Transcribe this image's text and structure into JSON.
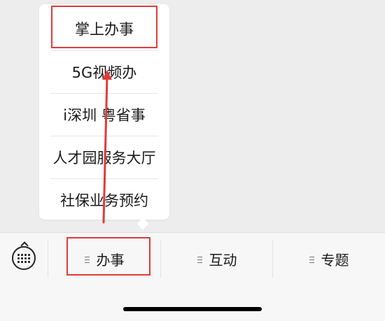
{
  "popup_menu": {
    "items": [
      {
        "label": "掌上办事"
      },
      {
        "label": "5G视频办"
      },
      {
        "label": "i深圳 粤省事"
      },
      {
        "label": "人才园服务大厅"
      },
      {
        "label": "社保业务预约"
      }
    ]
  },
  "bottom_bar": {
    "keyboard_icon": "keyboard-icon",
    "tabs": [
      {
        "label": "办事",
        "icon": "menu-lines-icon"
      },
      {
        "label": "互动",
        "icon": "menu-lines-icon"
      },
      {
        "label": "专题",
        "icon": "menu-lines-icon"
      }
    ]
  },
  "annotation": {
    "color": "#e03b3b"
  }
}
